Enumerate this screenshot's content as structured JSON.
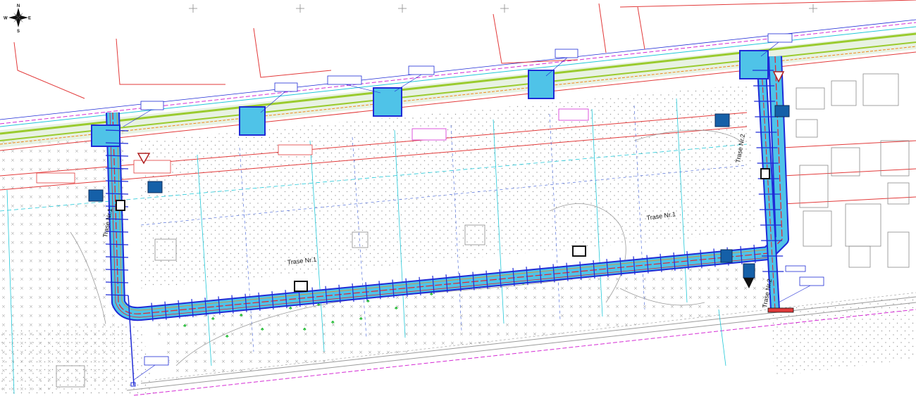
{
  "compass": {
    "north": "N",
    "south": "S",
    "east": "E",
    "west": "W"
  },
  "routes": [
    {
      "label": "Trase Nr.1",
      "segment": "upper"
    },
    {
      "label": "Trase Nr.1",
      "segment": "lower"
    },
    {
      "label": "Trase Nr.1",
      "segment": "left-vertical"
    },
    {
      "label": "Trase Nr.2",
      "segment": "right-upper"
    },
    {
      "label": "Trase Nr.2",
      "segment": "right-lower"
    }
  ],
  "colors": {
    "route_fill": "#4fc3e8",
    "route_edge": "#1f2bd6",
    "cable_red": "#e8202a",
    "boundary_red": "#e23a3a",
    "road_green": "#9acb2e",
    "cyan_line": "#22c8d8",
    "magenta": "#d42bd4",
    "orange": "#f08a1c",
    "gray_line": "#9a9a9a",
    "tree_green": "#22bb33",
    "sign_blue": "#1560a8"
  }
}
